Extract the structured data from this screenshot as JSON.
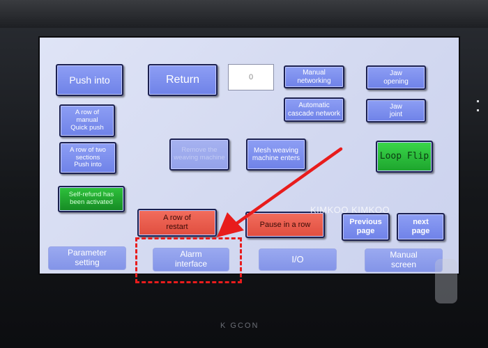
{
  "screen": {
    "buttons": {
      "push_into": "Push into",
      "return": "Return",
      "counter_value": "0",
      "manual_networking": "Manual\nnetworking",
      "jaw_opening": "Jaw\nopening",
      "automatic_cascade": "Automatic\ncascade network",
      "jaw_joint": "Jaw\njoint",
      "row_manual_quick": "A row of\nmanual\nQuick push",
      "row_two_sections": "A row of two\nsections\nPush into",
      "remove_weaving": "Remove the\nweaving machine",
      "mesh_weaving": "Mesh weaving\nmachine enters",
      "loop_flip": "Loop Flip",
      "self_refund": "Self-refund has\nbeen activated",
      "row_restart": "A row of\nrestart",
      "pause_row": "Pause in a row",
      "previous_page": "Previous\npage",
      "next_page": "next\npage"
    },
    "bottom_nav": {
      "parameter_setting": "Parameter\nsetting",
      "alarm_interface": "Alarm\ninterface",
      "io": "I/O",
      "manual_screen": "Manual\nscreen"
    },
    "watermark": "KIMKOO KIMKOO"
  },
  "device": {
    "brand": "K GCON"
  },
  "colors": {
    "button_blue": "#7b8cee",
    "active_green": "#2fca3f",
    "active_red": "#ea5d4d",
    "annotation_red": "#e81c1c",
    "screen_bg": "#d8ddf3"
  }
}
